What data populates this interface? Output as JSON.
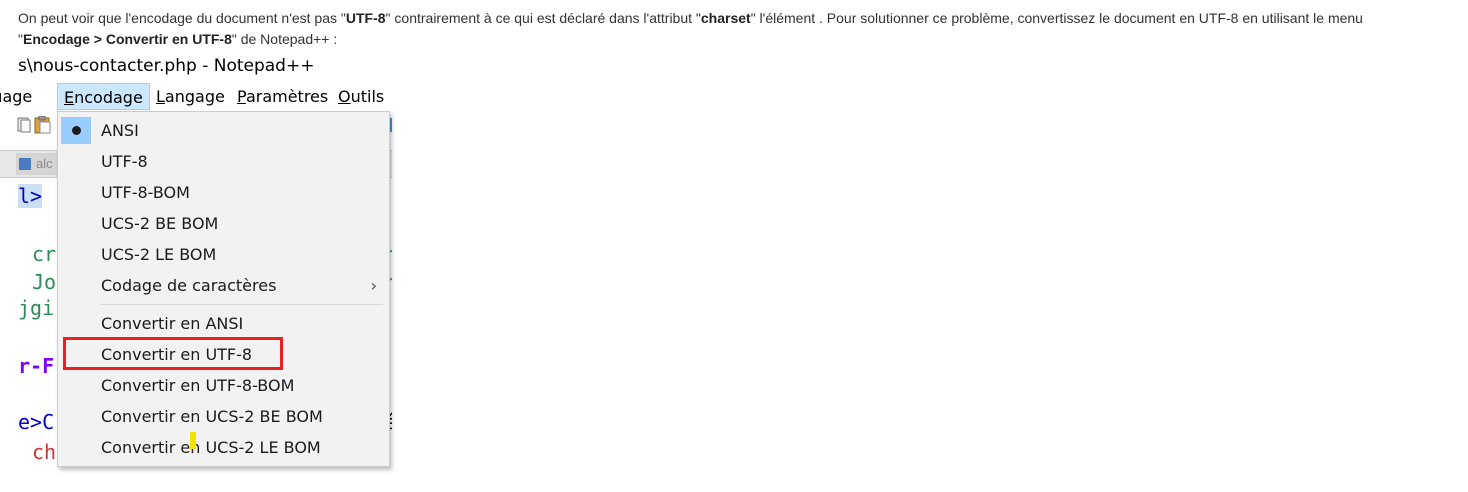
{
  "intro": {
    "p1": "On peut voir que l'encodage du document n'est pas \"",
    "b1": "UTF-8",
    "p2": "\" contrairement à ce qui est déclaré dans l'attribut \"",
    "b2": "charset",
    "p3": "\" l'élément . Pour solutionner ce problème, convertissez le document en UTF-8 en utilisant le menu",
    "p4": "\"",
    "b3": "Encodage > Convertir en UTF-8",
    "p5": "\" de Notepad++ :"
  },
  "window": {
    "title": "s\\nous-contacter.php - Notepad++"
  },
  "menubar": {
    "items": [
      {
        "pre": "",
        "ul": "",
        "post": "ıage"
      },
      {
        "pre": "",
        "ul": "E",
        "post": "ncodage"
      },
      {
        "pre": "",
        "ul": "L",
        "post": "angage"
      },
      {
        "pre": "",
        "ul": "P",
        "post": "aramètres"
      },
      {
        "pre": "",
        "ul": "O",
        "post": "utils"
      }
    ]
  },
  "tab": {
    "label": "alc"
  },
  "code_lines": [
    {
      "text": "l>",
      "color": "#0000cc"
    },
    {
      "text": "cr",
      "color": "#2e8b57"
    },
    {
      "text": "Jo",
      "color": "#2e8b57"
    },
    {
      "text": "jgi",
      "color": "#2e8b57"
    },
    {
      "text": "r-F",
      "color": "#7f00ff"
    },
    {
      "text": "e>C",
      "color": "#0000cc"
    },
    {
      "text": "ch",
      "color": "#cc3333"
    }
  ],
  "code_right": {
    "r1": "r",
    "r2": "r",
    "r3": "é"
  },
  "encoding_menu": {
    "items": [
      {
        "label": "ANSI",
        "checked": true
      },
      {
        "label": "UTF-8"
      },
      {
        "label": "UTF-8-BOM"
      },
      {
        "label": "UCS-2 BE BOM"
      },
      {
        "label": "UCS-2 LE BOM"
      },
      {
        "label": "Codage de caractères",
        "submenu": "›"
      },
      {
        "label": "Convertir en ANSI"
      },
      {
        "label": "Convertir en UTF-8",
        "highlighted": true
      },
      {
        "label": "Convertir en UTF-8-BOM"
      },
      {
        "label": "Convertir en UCS-2 BE BOM"
      },
      {
        "label": "Convertir en UCS-2 LE BOM"
      }
    ]
  },
  "colors": {
    "menu_active_bg": "#cce8ff",
    "check_bg": "#99ccff",
    "highlight_border": "#e8221c"
  }
}
